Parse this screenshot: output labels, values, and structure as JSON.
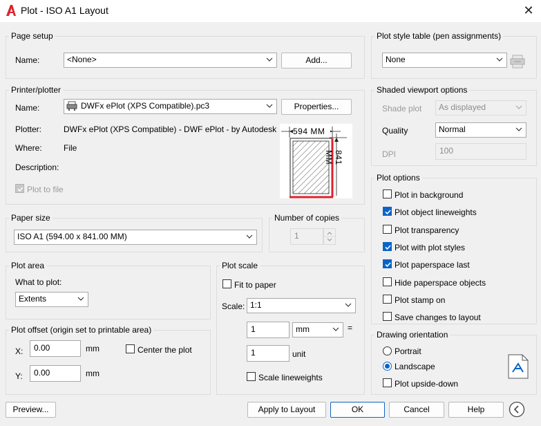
{
  "window": {
    "title": "Plot - ISO A1 Layout"
  },
  "page_setup": {
    "group": "Page setup",
    "name_label": "Name:",
    "name_value": "<None>",
    "add_button": "Add..."
  },
  "printer": {
    "group": "Printer/plotter",
    "name_label": "Name:",
    "name_value": "DWFx ePlot (XPS Compatible).pc3",
    "properties_button": "Properties...",
    "plotter_label": "Plotter:",
    "plotter_value": "DWFx ePlot (XPS Compatible) - DWF ePlot - by Autodesk",
    "where_label": "Where:",
    "where_value": "File",
    "description_label": "Description:",
    "plot_to_file": "Plot to file",
    "preview_width": "594 MM",
    "preview_height": "841 MM"
  },
  "paper_size": {
    "group": "Paper size",
    "value": "ISO A1 (594.00 x 841.00 MM)"
  },
  "copies": {
    "group": "Number of copies",
    "value": "1"
  },
  "plot_area": {
    "group": "Plot area",
    "what_label": "What to plot:",
    "what_value": "Extents"
  },
  "plot_offset": {
    "group": "Plot offset (origin set to printable area)",
    "x_label": "X:",
    "x_value": "0.00",
    "x_unit": "mm",
    "y_label": "Y:",
    "y_value": "0.00",
    "y_unit": "mm",
    "center": "Center the plot"
  },
  "plot_scale": {
    "group": "Plot scale",
    "fit": "Fit to paper",
    "scale_label": "Scale:",
    "scale_value": "1:1",
    "value1": "1",
    "unit1": "mm",
    "equals": "=",
    "value2": "1",
    "unit2": "unit",
    "lineweights": "Scale lineweights"
  },
  "plot_style_table": {
    "group": "Plot style table (pen assignments)",
    "value": "None"
  },
  "shaded": {
    "group": "Shaded viewport options",
    "shade_label": "Shade plot",
    "shade_value": "As displayed",
    "quality_label": "Quality",
    "quality_value": "Normal",
    "dpi_label": "DPI",
    "dpi_value": "100"
  },
  "plot_options": {
    "group": "Plot options",
    "items": [
      {
        "label": "Plot in background",
        "checked": false
      },
      {
        "label": "Plot object lineweights",
        "checked": true
      },
      {
        "label": "Plot transparency",
        "checked": false
      },
      {
        "label": "Plot with plot styles",
        "checked": true
      },
      {
        "label": "Plot paperspace last",
        "checked": true
      },
      {
        "label": "Hide paperspace objects",
        "checked": false
      },
      {
        "label": "Plot stamp on",
        "checked": false
      },
      {
        "label": "Save changes to layout",
        "checked": false
      }
    ]
  },
  "orientation": {
    "group": "Drawing orientation",
    "portrait": "Portrait",
    "landscape": "Landscape",
    "upside_down": "Plot upside-down",
    "selected": "landscape"
  },
  "footer": {
    "preview": "Preview...",
    "apply": "Apply to Layout",
    "ok": "OK",
    "cancel": "Cancel",
    "help": "Help"
  },
  "colors": {
    "accent": "#0a64c8",
    "paper_edge": "#e0202a",
    "app_icon": "#d8262c"
  }
}
